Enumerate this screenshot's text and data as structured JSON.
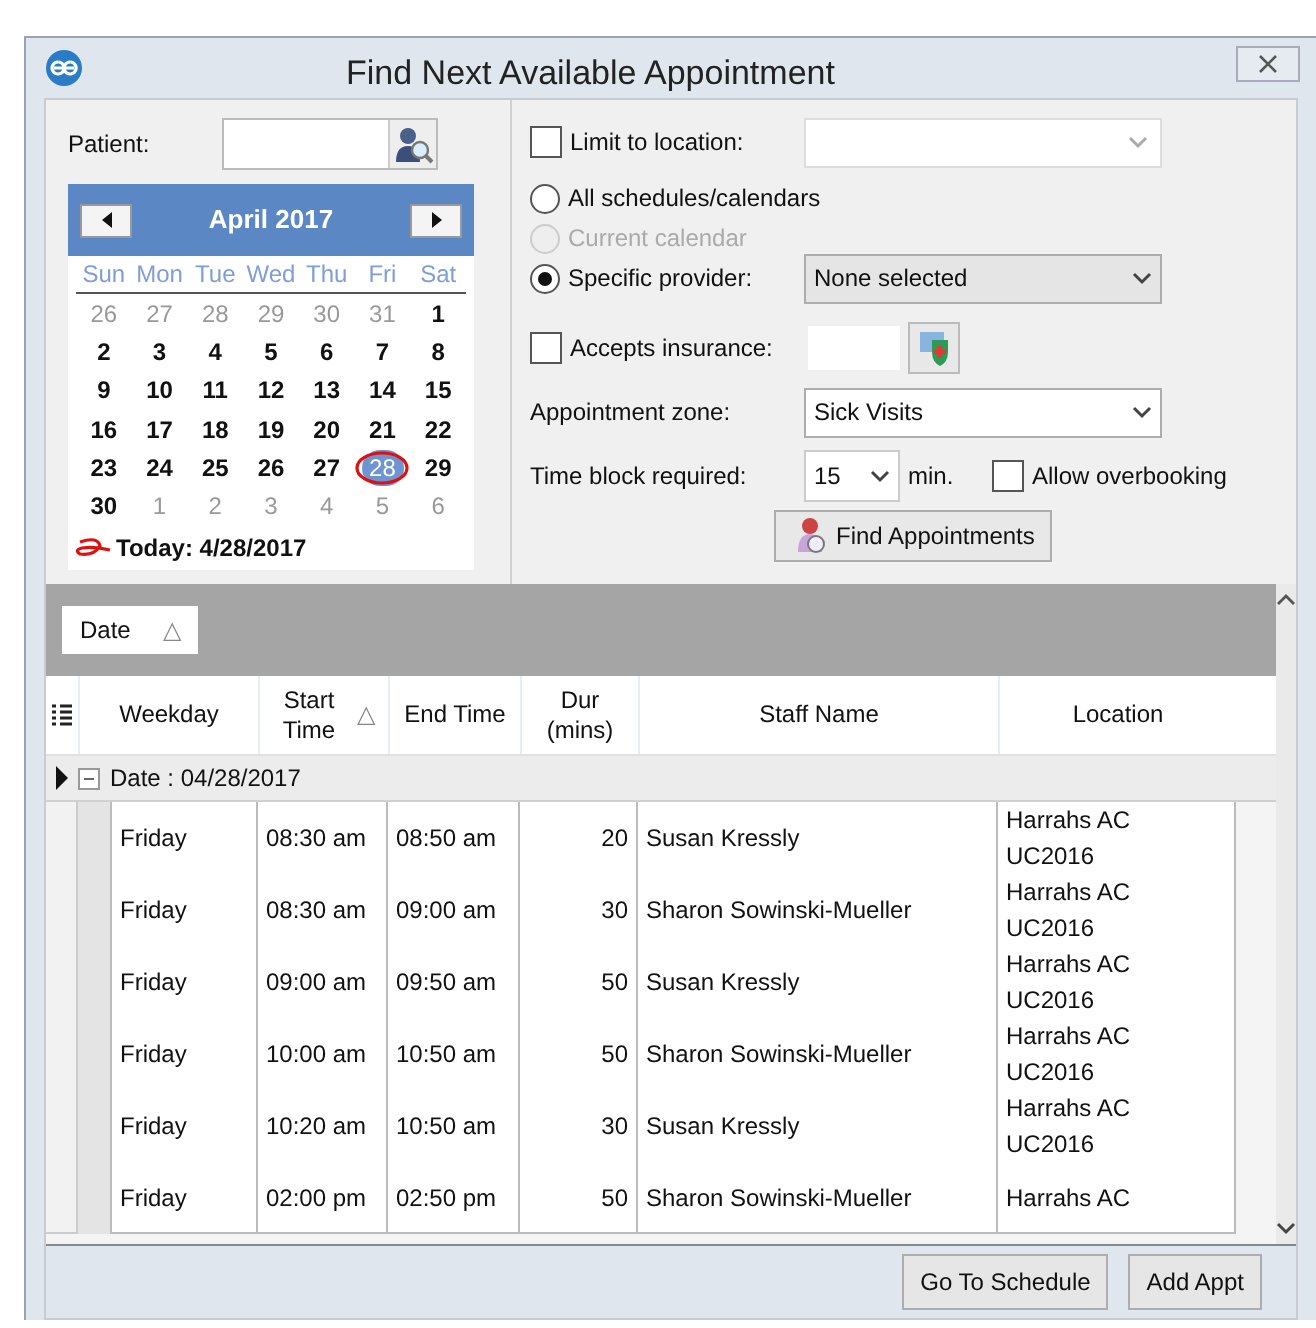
{
  "window": {
    "title": "Find Next Available Appointment"
  },
  "patient": {
    "label": "Patient:"
  },
  "calendar": {
    "month": "April 2017",
    "weekdays": [
      "Sun",
      "Mon",
      "Tue",
      "Wed",
      "Thu",
      "Fri",
      "Sat"
    ],
    "weeks": [
      [
        {
          "day": "26",
          "muted": true,
          "selected": false
        },
        {
          "day": "27",
          "muted": true,
          "selected": false
        },
        {
          "day": "28",
          "muted": true,
          "selected": false
        },
        {
          "day": "29",
          "muted": true,
          "selected": false
        },
        {
          "day": "30",
          "muted": true,
          "selected": false
        },
        {
          "day": "31",
          "muted": true,
          "selected": false
        },
        {
          "day": "1",
          "muted": false,
          "selected": false
        }
      ],
      [
        {
          "day": "2",
          "muted": false,
          "selected": false
        },
        {
          "day": "3",
          "muted": false,
          "selected": false
        },
        {
          "day": "4",
          "muted": false,
          "selected": false
        },
        {
          "day": "5",
          "muted": false,
          "selected": false
        },
        {
          "day": "6",
          "muted": false,
          "selected": false
        },
        {
          "day": "7",
          "muted": false,
          "selected": false
        },
        {
          "day": "8",
          "muted": false,
          "selected": false
        }
      ],
      [
        {
          "day": "9",
          "muted": false,
          "selected": false
        },
        {
          "day": "10",
          "muted": false,
          "selected": false
        },
        {
          "day": "11",
          "muted": false,
          "selected": false
        },
        {
          "day": "12",
          "muted": false,
          "selected": false
        },
        {
          "day": "13",
          "muted": false,
          "selected": false
        },
        {
          "day": "14",
          "muted": false,
          "selected": false
        },
        {
          "day": "15",
          "muted": false,
          "selected": false
        }
      ],
      [
        {
          "day": "16",
          "muted": false,
          "selected": false
        },
        {
          "day": "17",
          "muted": false,
          "selected": false
        },
        {
          "day": "18",
          "muted": false,
          "selected": false
        },
        {
          "day": "19",
          "muted": false,
          "selected": false
        },
        {
          "day": "20",
          "muted": false,
          "selected": false
        },
        {
          "day": "21",
          "muted": false,
          "selected": false
        },
        {
          "day": "22",
          "muted": false,
          "selected": false
        }
      ],
      [
        {
          "day": "23",
          "muted": false,
          "selected": false
        },
        {
          "day": "24",
          "muted": false,
          "selected": false
        },
        {
          "day": "25",
          "muted": false,
          "selected": false
        },
        {
          "day": "26",
          "muted": false,
          "selected": false
        },
        {
          "day": "27",
          "muted": false,
          "selected": false
        },
        {
          "day": "28",
          "muted": false,
          "selected": true
        },
        {
          "day": "29",
          "muted": false,
          "selected": false
        }
      ],
      [
        {
          "day": "30",
          "muted": false,
          "selected": false
        },
        {
          "day": "1",
          "muted": true,
          "selected": false
        },
        {
          "day": "2",
          "muted": true,
          "selected": false
        },
        {
          "day": "3",
          "muted": true,
          "selected": false
        },
        {
          "day": "4",
          "muted": true,
          "selected": false
        },
        {
          "day": "5",
          "muted": true,
          "selected": false
        },
        {
          "day": "6",
          "muted": true,
          "selected": false
        }
      ]
    ],
    "today": "Today: 4/28/2017"
  },
  "limit_to_location": {
    "label": "Limit to location:",
    "checked": false
  },
  "schedule_options": [
    {
      "label": "All schedules/calendars",
      "selected": false,
      "disabled": false
    },
    {
      "label": "Current calendar",
      "selected": false,
      "disabled": true
    },
    {
      "label": "Specific provider:",
      "selected": true,
      "disabled": false
    }
  ],
  "provider": {
    "value": "None selected"
  },
  "accepts_insurance": {
    "label": "Accepts insurance:",
    "checked": false
  },
  "appointment_zone": {
    "label": "Appointment zone:",
    "value": "Sick Visits"
  },
  "time_block": {
    "label": "Time block required:",
    "value": "15",
    "unit": "min."
  },
  "allow_overbooking": {
    "label": "Allow overbooking",
    "checked": false
  },
  "find_button": {
    "label": "Find Appointments"
  },
  "grid": {
    "group_by": "Date",
    "group_sort": "△",
    "columns": [
      {
        "label": "Weekday"
      },
      {
        "label": "Start Time",
        "sort": "△"
      },
      {
        "label": "End Time"
      },
      {
        "label": "Dur (mins)"
      },
      {
        "label": "Staff Name"
      },
      {
        "label": "Location"
      }
    ],
    "group": {
      "label": "Date : 04/28/2017",
      "expanded": true
    },
    "rows": [
      [
        "Friday",
        "08:30 am",
        "08:50 am",
        "20",
        "Susan Kressly",
        "Harrahs AC UC2016"
      ],
      [
        "Friday",
        "08:30 am",
        "09:00 am",
        "30",
        "Sharon Sowinski-Mueller",
        "Harrahs AC UC2016"
      ],
      [
        "Friday",
        "09:00 am",
        "09:50 am",
        "50",
        "Susan Kressly",
        "Harrahs AC UC2016"
      ],
      [
        "Friday",
        "10:00 am",
        "10:50 am",
        "50",
        "Sharon Sowinski-Mueller",
        "Harrahs AC UC2016"
      ],
      [
        "Friday",
        "10:20 am",
        "10:50 am",
        "30",
        "Susan Kressly",
        "Harrahs AC UC2016"
      ],
      [
        "Friday",
        "02:00 pm",
        "02:50 pm",
        "50",
        "Sharon Sowinski-Mueller",
        "Harrahs AC"
      ]
    ]
  },
  "buttons": [
    {
      "label": "Go To Schedule"
    },
    {
      "label": "Add Appt"
    }
  ]
}
